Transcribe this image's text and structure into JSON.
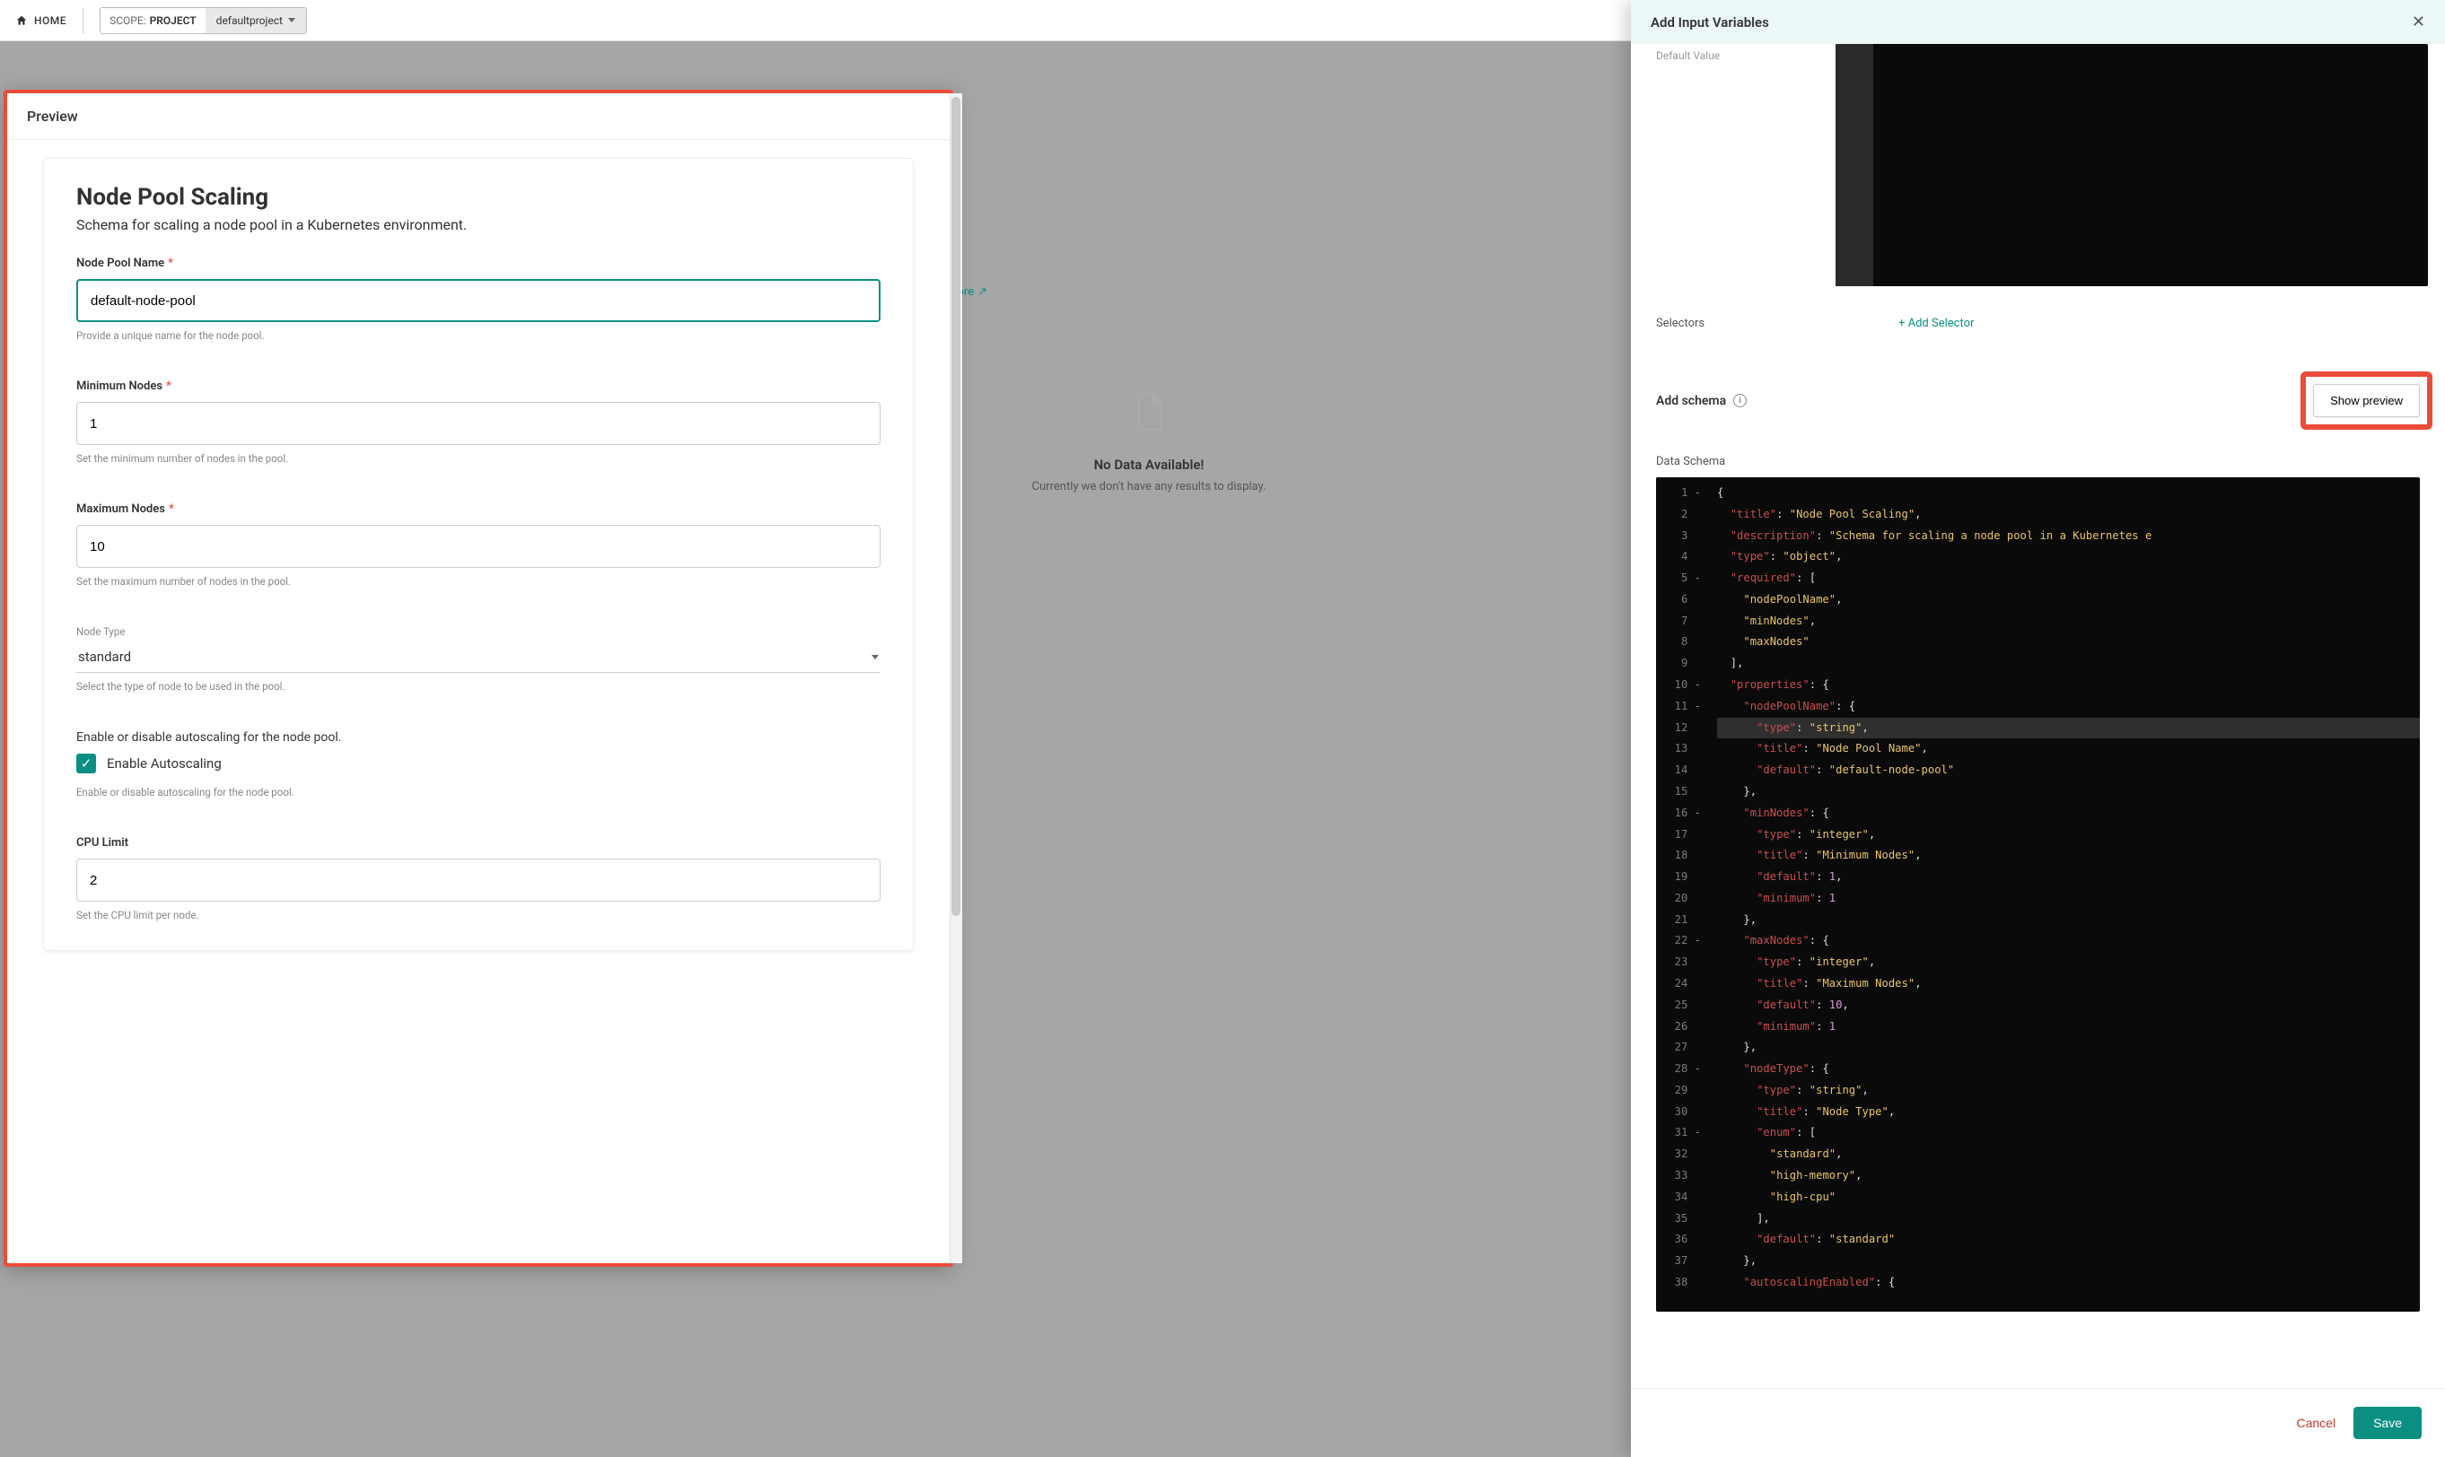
{
  "header": {
    "home": "HOME",
    "scopeLabel": "SCOPE:",
    "scopeType": "PROJECT",
    "scopeValue": "defaultproject"
  },
  "background": {
    "learnMore": "more",
    "noDataTitle": "No Data Available!",
    "noDataSub": "Currently we don't have any results to display."
  },
  "preview": {
    "panelTitle": "Preview",
    "formTitle": "Node Pool Scaling",
    "formDesc": "Schema for scaling a node pool in a Kubernetes environment.",
    "fields": {
      "name": {
        "label": "Node Pool Name",
        "value": "default-node-pool",
        "help": "Provide a unique name for the node pool."
      },
      "min": {
        "label": "Minimum Nodes",
        "value": "1",
        "help": "Set the minimum number of nodes in the pool."
      },
      "max": {
        "label": "Maximum Nodes",
        "value": "10",
        "help": "Set the maximum number of nodes in the pool."
      },
      "type": {
        "label": "Node Type",
        "value": "standard",
        "help": "Select the type of node to be used in the pool."
      },
      "auto": {
        "groupLabel": "Enable or disable autoscaling for the node pool.",
        "checkLabel": "Enable Autoscaling",
        "checked": true,
        "help": "Enable or disable autoscaling for the node pool."
      },
      "cpu": {
        "label": "CPU Limit",
        "value": "2",
        "help": "Set the CPU limit per node."
      }
    }
  },
  "sidebar": {
    "title": "Add Input Variables",
    "defaultValueLabel": "Default Value",
    "selectorsLabel": "Selectors",
    "addSelector": "+ Add Selector",
    "addSchemaLabel": "Add schema",
    "showPreview": "Show preview",
    "dataSchemaLabel": "Data Schema",
    "cancel": "Cancel",
    "save": "Save",
    "code": {
      "lines": 38,
      "highlightLine": 12,
      "text": [
        "{",
        "  \"title\": \"Node Pool Scaling\",",
        "  \"description\": \"Schema for scaling a node pool in a Kubernetes e",
        "  \"type\": \"object\",",
        "  \"required\": [",
        "    \"nodePoolName\",",
        "    \"minNodes\",",
        "    \"maxNodes\"",
        "  ],",
        "  \"properties\": {",
        "    \"nodePoolName\": {",
        "      \"type\": \"string\",",
        "      \"title\": \"Node Pool Name\",",
        "      \"default\": \"default-node-pool\"",
        "    },",
        "    \"minNodes\": {",
        "      \"type\": \"integer\",",
        "      \"title\": \"Minimum Nodes\",",
        "      \"default\": 1,",
        "      \"minimum\": 1",
        "    },",
        "    \"maxNodes\": {",
        "      \"type\": \"integer\",",
        "      \"title\": \"Maximum Nodes\",",
        "      \"default\": 10,",
        "      \"minimum\": 1",
        "    },",
        "    \"nodeType\": {",
        "      \"type\": \"string\",",
        "      \"title\": \"Node Type\",",
        "      \"enum\": [",
        "        \"standard\",",
        "        \"high-memory\",",
        "        \"high-cpu\"",
        "      ],",
        "      \"default\": \"standard\"",
        "    },",
        "    \"autoscalingEnabled\": {"
      ]
    }
  }
}
